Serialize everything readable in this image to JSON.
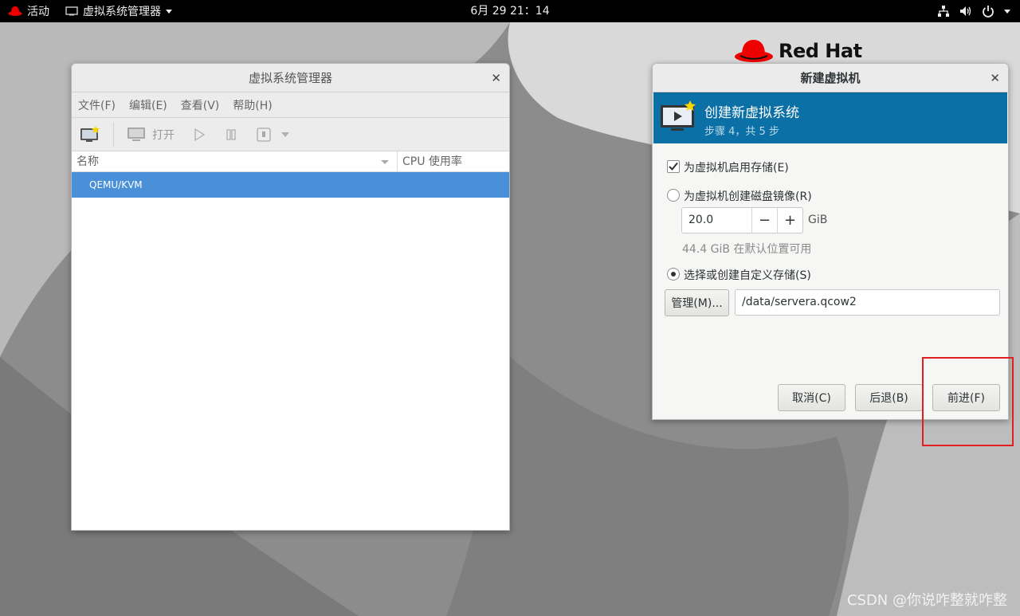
{
  "topbar": {
    "activities_label": "活动",
    "app_menu_label": "虚拟系统管理器",
    "clock": "6月 29  21：14",
    "icons": [
      "network-icon",
      "volume-icon",
      "power-icon"
    ]
  },
  "brand": {
    "logo_text": "Red Hat",
    "logo_color": "#ee0000"
  },
  "manager_window": {
    "title": "虚拟系统管理器",
    "menu": [
      "文件(F)",
      "编辑(E)",
      "查看(V)",
      "帮助(H)"
    ],
    "toolbar": {
      "open_label": "打开"
    },
    "columns": {
      "name": "名称",
      "cpu": "CPU 使用率"
    },
    "rows": [
      "QEMU/KVM"
    ]
  },
  "new_vm_dialog": {
    "title": "新建虚拟机",
    "banner": {
      "title": "创建新虚拟系统",
      "step": "步骤 4，共 5 步",
      "color": "#0b70a5"
    },
    "enable_storage": {
      "label": "为虚拟机启用存储(E)",
      "checked": true
    },
    "create_disk": {
      "label": "为虚拟机创建磁盘镜像(R)",
      "selected": false
    },
    "disk_size": {
      "value": "20.0",
      "unit": "GiB",
      "minus": "−",
      "plus": "+"
    },
    "available_text": "44.4 GiB 在默认位置可用",
    "custom_storage": {
      "label": "选择或创建自定义存储(S)",
      "selected": true
    },
    "manage_button": "管理(M)...",
    "path_value": "/data/servera.qcow2",
    "buttons": {
      "cancel": "取消(C)",
      "back": "后退(B)",
      "forward": "前进(F)"
    }
  },
  "highlight_color": "#e02020",
  "watermark": "CSDN @你说咋整就咋整"
}
